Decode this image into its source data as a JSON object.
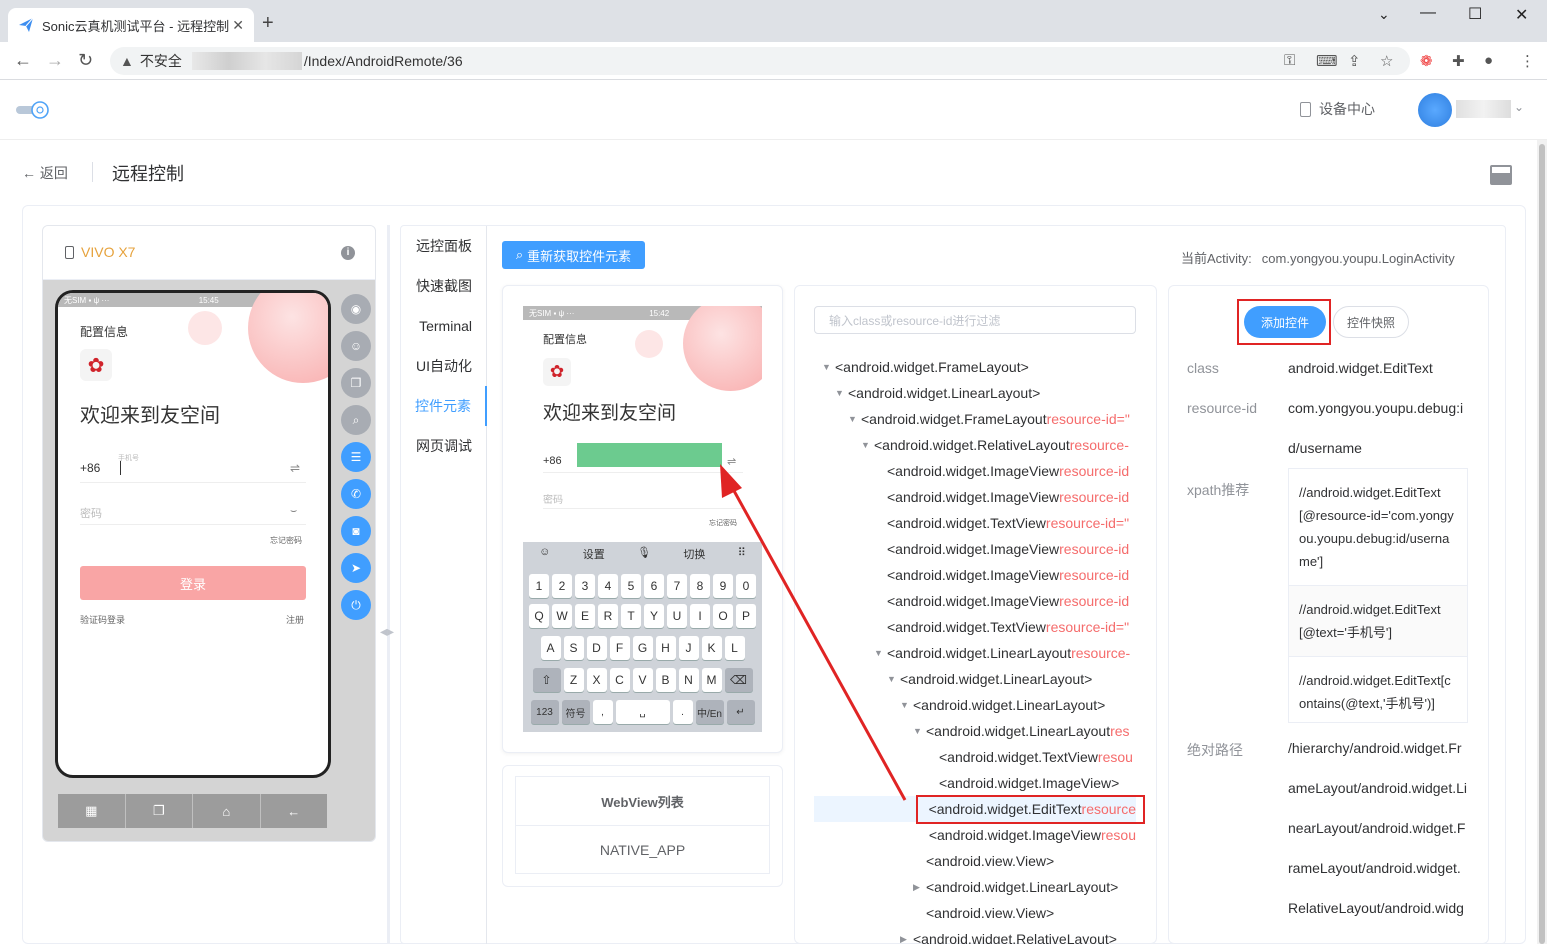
{
  "browser": {
    "tab_title": "Sonic云真机测试平台 - 远程控制",
    "tab_close": "✕",
    "new_tab": "+",
    "security_label": "不安全",
    "url_path": "/Index/AndroidRemote/36",
    "window": {
      "minimize": "⌄",
      "min": "—",
      "max": "☐",
      "close": "✕"
    }
  },
  "header": {
    "device_center": "设备中心"
  },
  "page": {
    "back_label": "返回",
    "title": "远程控制"
  },
  "device": {
    "name": "VIVO X7",
    "info_icon": "i",
    "screen": {
      "status_left": "无SIM ▪ ψ ···",
      "status_time": "15:45",
      "config_title": "配置信息",
      "welcome": "欢迎来到友空间",
      "country_code": "+86",
      "phone_hint": "手机号",
      "password_placeholder": "密码",
      "forgot_password": "忘记密码",
      "login_button": "登录",
      "sms_login": "验证码登录",
      "register": "注册"
    }
  },
  "tabs": [
    {
      "label": "远控面板"
    },
    {
      "label": "快速截图"
    },
    {
      "label": "Terminal"
    },
    {
      "label": "UI自动化"
    },
    {
      "label": "控件元素"
    },
    {
      "label": "网页调试"
    }
  ],
  "toolbar": {
    "refresh_label": "重新获取控件元素",
    "activity_label": "当前Activity:",
    "activity_value": "com.yongyou.youpu.LoginActivity"
  },
  "screenshot": {
    "status_left": "无SIM ▪ ψ ···",
    "status_time": "15:42",
    "config_title": "配置信息",
    "welcome": "欢迎来到友空间",
    "country_code": "+86",
    "password_placeholder": "密码",
    "forgot_password": "忘记密码",
    "kb_toolbar": [
      "☺",
      "设置",
      "🎙",
      "切换",
      "⠿"
    ],
    "kb_row1": [
      "1",
      "2",
      "3",
      "4",
      "5",
      "6",
      "7",
      "8",
      "9",
      "0"
    ],
    "kb_row2": [
      "Q",
      "W",
      "E",
      "R",
      "T",
      "Y",
      "U",
      "I",
      "O",
      "P"
    ],
    "kb_row3": [
      "A",
      "S",
      "D",
      "F",
      "G",
      "H",
      "J",
      "K",
      "L"
    ],
    "kb_row4": [
      "⇧",
      "Z",
      "X",
      "C",
      "V",
      "B",
      "N",
      "M",
      "⌫"
    ],
    "kb_row5": [
      "123",
      "符号",
      ",",
      "␣",
      ".",
      "中/En",
      "↵"
    ]
  },
  "webview": {
    "header": "WebView列表",
    "row": "NATIVE_APP"
  },
  "tree": {
    "filter_placeholder": "输入class或resource-id进行过滤",
    "nodes": [
      {
        "arrow": "▼",
        "text": "<android.widget.FrameLayout>",
        "rid": ""
      },
      {
        "arrow": "▼",
        "text": "<android.widget.LinearLayout>",
        "rid": ""
      },
      {
        "arrow": "▼",
        "text": "<android.widget.FrameLayout ",
        "rid": "resource-id=\""
      },
      {
        "arrow": "▼",
        "text": "<android.widget.RelativeLayout ",
        "rid": "resource-"
      },
      {
        "arrow": "",
        "text": "<android.widget.ImageView ",
        "rid": "resource-id"
      },
      {
        "arrow": "",
        "text": "<android.widget.ImageView ",
        "rid": "resource-id"
      },
      {
        "arrow": "",
        "text": "<android.widget.TextView ",
        "rid": "resource-id=\""
      },
      {
        "arrow": "",
        "text": "<android.widget.ImageView ",
        "rid": "resource-id"
      },
      {
        "arrow": "",
        "text": "<android.widget.ImageView ",
        "rid": "resource-id"
      },
      {
        "arrow": "",
        "text": "<android.widget.ImageView ",
        "rid": "resource-id"
      },
      {
        "arrow": "",
        "text": "<android.widget.TextView ",
        "rid": "resource-id=\""
      },
      {
        "arrow": "▼",
        "text": "<android.widget.LinearLayout ",
        "rid": "resource-"
      },
      {
        "arrow": "▼",
        "text": "<android.widget.LinearLayout>",
        "rid": ""
      },
      {
        "arrow": "▼",
        "text": "<android.widget.LinearLayout>",
        "rid": ""
      },
      {
        "arrow": "▼",
        "text": "<android.widget.LinearLayout ",
        "rid": "res"
      },
      {
        "arrow": "",
        "text": "<android.widget.TextView ",
        "rid": "resou"
      },
      {
        "arrow": "",
        "text": "<android.widget.ImageView>",
        "rid": ""
      },
      {
        "arrow": "",
        "text": "<android.widget.EditText ",
        "rid": "resource"
      },
      {
        "arrow": "",
        "text": "<android.widget.ImageView ",
        "rid": "resou"
      },
      {
        "arrow": "",
        "text": "<android.view.View>",
        "rid": ""
      },
      {
        "arrow": "▶",
        "text": "<android.widget.LinearLayout>",
        "rid": ""
      },
      {
        "arrow": "",
        "text": "<android.view.View>",
        "rid": ""
      },
      {
        "arrow": "▶",
        "text": "<android.widget.RelativeLayout>",
        "rid": ""
      }
    ]
  },
  "attributes": {
    "add_button": "添加控件",
    "snapshot_button": "控件快照",
    "class_label": "class",
    "class_value": "android.widget.EditText",
    "rid_label": "resource-id",
    "rid_value_1": "com.yongyou.youpu.debug:i",
    "rid_value_2": "d/username",
    "xpath_label": "xpath推荐",
    "xpaths": [
      "//android.widget.EditText[@resource-id='com.yongyou.youpu.debug:id/username']",
      "//android.widget.EditText[@text='手机号']",
      "//android.widget.EditText[contains(@text,'手机号')]"
    ],
    "abs_label": "绝对路径",
    "abs_lines": [
      "/hierarchy/android.widget.Fr",
      "ameLayout/android.widget.Li",
      "nearLayout/android.widget.F",
      "rameLayout/android.widget.",
      "RelativeLayout/android.widg"
    ]
  },
  "colors": {
    "primary": "#409eff",
    "highlight_red": "#e02424",
    "device_name": "#e6a23c",
    "selection_green": "#6ccb8f",
    "login_pink": "#f9a5a5"
  }
}
